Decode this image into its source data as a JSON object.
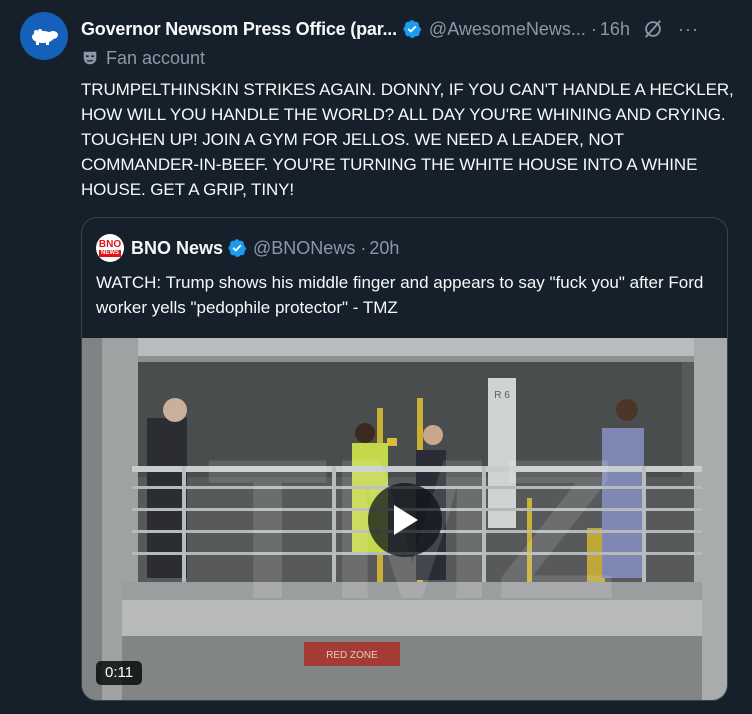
{
  "tweet": {
    "author": {
      "display_name": "Governor Newsom Press Office (par...",
      "handle": "@AwesomeNews...",
      "avatar_icon": "hippo-icon"
    },
    "separator": "·",
    "time": "16h",
    "label": "Fan account",
    "text": "TRUMPELTHINSKIN STRIKES AGAIN. DONNY, IF YOU CAN'T HANDLE A HECKLER, HOW WILL YOU HANDLE THE WORLD? ALL DAY YOU'RE WHINING AND CRYING. TOUGHEN UP! JOIN A GYM FOR JELLOS. WE NEED A LEADER, NOT COMMANDER-IN-BEEF. YOU'RE TURNING THE WHITE HOUSE INTO A WHINE HOUSE. GET A GRIP, TINY!",
    "more_label": "···"
  },
  "quote": {
    "logo_top": "BNO",
    "logo_bottom": "NEWS",
    "display_name": "BNO News",
    "handle": "@BNONews",
    "separator": "·",
    "time": "20h",
    "text": "WATCH: Trump shows his middle finger and appears to say \"fuck you\" after Ford worker yells \"pedophile protector\" - TMZ",
    "video": {
      "duration": "0:11",
      "pillar_label": "R 6",
      "sign_label": "RED ZONE",
      "watermark": "TMZ"
    }
  },
  "colors": {
    "background": "#15202b",
    "verified": "#1d9bf0",
    "muted": "#8b98a5",
    "border": "#38444d"
  }
}
